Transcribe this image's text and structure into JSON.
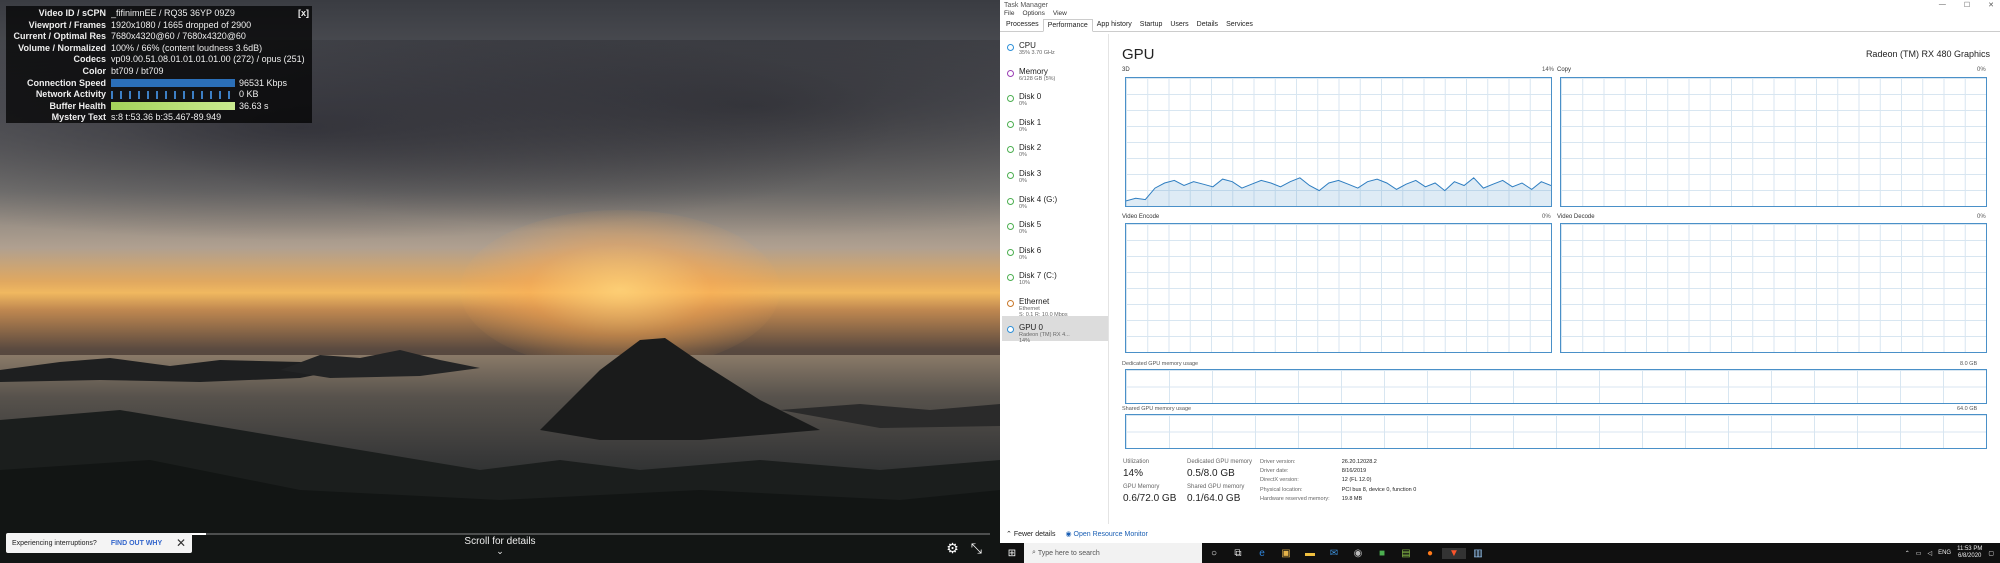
{
  "video": {
    "stats": {
      "close_label": "[x]",
      "rows": [
        {
          "key": "Video ID / sCPN",
          "value": "_fifinimnEE / RQ35 36YP 09Z9"
        },
        {
          "key": "Viewport / Frames",
          "value": "1920x1080 / 1665 dropped of 2900"
        },
        {
          "key": "Current / Optimal Res",
          "value": "7680x4320@60 / 7680x4320@60"
        },
        {
          "key": "Volume / Normalized",
          "value": "100% / 66% (content loudness 3.6dB)"
        },
        {
          "key": "Codecs",
          "value": "vp09.00.51.08.01.01.01.01.00 (272) / opus (251)"
        },
        {
          "key": "Color",
          "value": "bt709 / bt709"
        },
        {
          "key": "Connection Speed",
          "value": "96531 Kbps"
        },
        {
          "key": "Network Activity",
          "value": "0 KB"
        },
        {
          "key": "Buffer Health",
          "value": "36.63 s"
        },
        {
          "key": "Mystery Text",
          "value": "s:8 t:53.36 b:35.467-89.949"
        }
      ],
      "connection_fill": 0.66,
      "buffer_fill": 0.4
    },
    "interruption": {
      "text": "Experiencing interruptions?",
      "link": "FIND OUT WHY",
      "close": "✕"
    },
    "scroll_label": "Scroll for details",
    "scroll_chevron": "⌄",
    "progress": 0.2,
    "controls": {
      "settings_icon": "⚙",
      "exit_fullscreen_icon": "⤡"
    }
  },
  "taskmgr": {
    "title": "Task Manager",
    "window_controls": [
      "—",
      "☐",
      "✕"
    ],
    "menu": [
      "File",
      "Options",
      "View"
    ],
    "tabs": [
      "Processes",
      "Performance",
      "App history",
      "Startup",
      "Users",
      "Details",
      "Services"
    ],
    "active_tab": "Performance",
    "sidebar": [
      {
        "name": "CPU",
        "sub1": "35% 3.70 GHz",
        "sub2": "",
        "color": "#2c8fd8"
      },
      {
        "name": "Memory",
        "sub1": "6/128 GB (5%)",
        "sub2": "",
        "color": "#9b3fb5"
      },
      {
        "name": "Disk 0",
        "sub1": "0%",
        "sub2": "",
        "color": "#4caf50"
      },
      {
        "name": "Disk 1",
        "sub1": "0%",
        "sub2": "",
        "color": "#4caf50"
      },
      {
        "name": "Disk 2",
        "sub1": "0%",
        "sub2": "",
        "color": "#4caf50"
      },
      {
        "name": "Disk 3",
        "sub1": "0%",
        "sub2": "",
        "color": "#4caf50"
      },
      {
        "name": "Disk 4 (G:)",
        "sub1": "0%",
        "sub2": "",
        "color": "#4caf50"
      },
      {
        "name": "Disk 5",
        "sub1": "0%",
        "sub2": "",
        "color": "#4caf50"
      },
      {
        "name": "Disk 6",
        "sub1": "0%",
        "sub2": "",
        "color": "#4caf50"
      },
      {
        "name": "Disk 7 (C:)",
        "sub1": "10%",
        "sub2": "",
        "color": "#4caf50"
      },
      {
        "name": "Ethernet",
        "sub1": "Ethernet",
        "sub2": "S: 0.1 R: 10.0 Mbps",
        "color": "#c8782a"
      },
      {
        "name": "GPU 0",
        "sub1": "Radeon (TM) RX 4...",
        "sub2": "14%",
        "color": "#2c8fd8"
      }
    ],
    "selected_index": 11,
    "gpu": {
      "title": "GPU",
      "name": "Radeon (TM) RX 480 Graphics",
      "engines": [
        {
          "label": "3D",
          "pct": "14%"
        },
        {
          "label": "Copy",
          "pct": "0%"
        },
        {
          "label": "Video Encode",
          "pct": "0%"
        },
        {
          "label": "Video Decode",
          "pct": "0%"
        }
      ],
      "dedicated_label": "Dedicated GPU memory usage",
      "dedicated_max": "8.0 GB",
      "shared_label": "Shared GPU memory usage",
      "shared_max": "64.0 GB",
      "threed_series": [
        4,
        6,
        5,
        14,
        18,
        20,
        16,
        19,
        17,
        15,
        21,
        19,
        14,
        17,
        20,
        18,
        15,
        19,
        22,
        16,
        12,
        18,
        20,
        17,
        14,
        19,
        21,
        18,
        13,
        17,
        20,
        15,
        18,
        12,
        19,
        16,
        22,
        14,
        17,
        20,
        15,
        18,
        13,
        19,
        16
      ]
    },
    "stats": {
      "utilization_label": "Utilization",
      "utilization": "14%",
      "dedicated_label": "Dedicated GPU memory",
      "dedicated": "0.5/8.0 GB",
      "gpu_memory_label": "GPU Memory",
      "gpu_memory": "0.6/72.0 GB",
      "shared_label": "Shared GPU memory",
      "shared": "0.1/64.0 GB"
    },
    "info": [
      {
        "k": "Driver version:",
        "v": "26.20.12028.2"
      },
      {
        "k": "Driver date:",
        "v": "8/16/2019"
      },
      {
        "k": "DirectX version:",
        "v": "12 (FL 12.0)"
      },
      {
        "k": "Physical location:",
        "v": "PCI bus 8, device 0, function 0"
      },
      {
        "k": "Hardware reserved memory:",
        "v": "19.8 MB"
      }
    ],
    "footer": {
      "fewer": "Fewer details",
      "monitor": "Open Resource Monitor"
    }
  },
  "taskbar": {
    "start_icon": "⊞",
    "search_placeholder": "Type here to search",
    "lang": "ENG",
    "time": "11:53 PM",
    "date": "6/8/2020"
  }
}
